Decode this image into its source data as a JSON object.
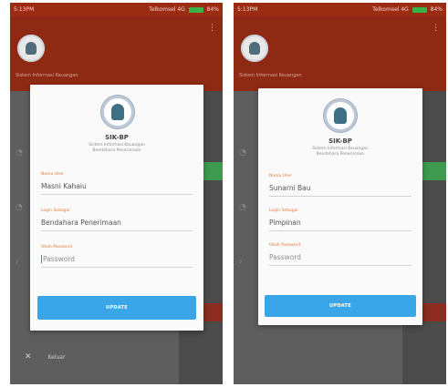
{
  "screens": [
    {
      "status": {
        "time": "5:13PM",
        "network": "Telkomsel 4G",
        "battery": "84%"
      },
      "app": {
        "title": "SIK-BP",
        "subtitle": "Sistem Informasi Keuangan\nBendahara Penerimaan"
      },
      "drawer_text": "Sistem Informasi Keuangan",
      "fields": [
        {
          "label": "Nama User",
          "value": "Masni Kahaiu"
        },
        {
          "label": "Login Sebagai",
          "value": "Bendahara Penerimaan"
        },
        {
          "label": "Ubah Password",
          "value": "",
          "placeholder": "Password"
        }
      ],
      "button": "UPDATE",
      "menu_item": "Keluar"
    },
    {
      "status": {
        "time": "5:13PM",
        "network": "Telkomsel 4G",
        "battery": "84%"
      },
      "app": {
        "title": "SIK-BP",
        "subtitle": "Sistem Informasi Keuangan\nBendahara Penerimaan"
      },
      "drawer_text": "Sistem Informasi Keuangan",
      "fields": [
        {
          "label": "Nama User",
          "value": "Sunarni Bau"
        },
        {
          "label": "Login Sebagai",
          "value": "Pimpinan"
        },
        {
          "label": "Ubah Password",
          "value": "",
          "placeholder": "Password"
        }
      ],
      "button": "UPDATE"
    }
  ],
  "colors": {
    "accent": "#3ba6e7",
    "header": "#8e2a14",
    "label": "#e07a3c"
  },
  "icons": [
    "logo-icon",
    "kebab-menu-icon",
    "battery-icon",
    "close-icon"
  ]
}
